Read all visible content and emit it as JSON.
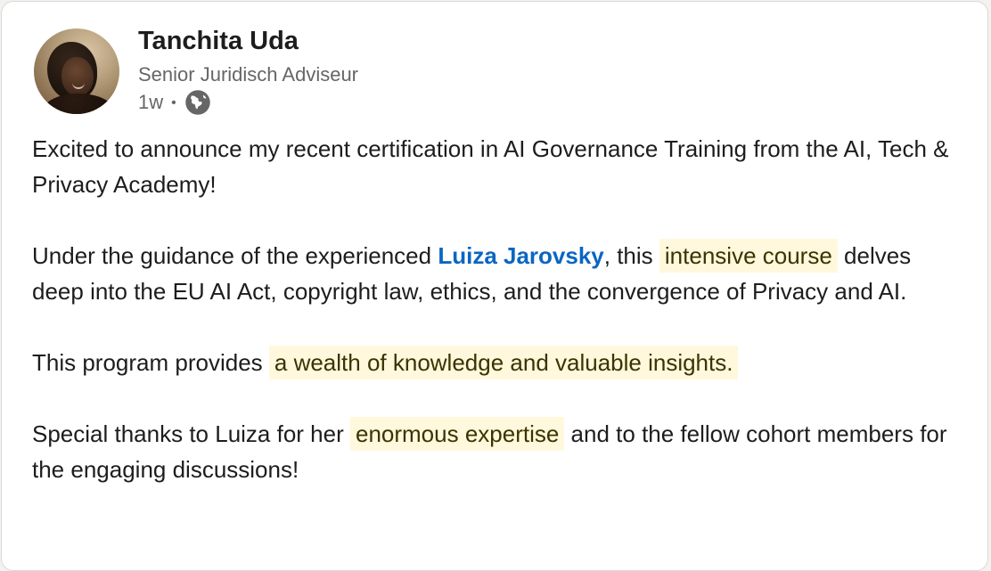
{
  "author": {
    "name": "Tanchita Uda",
    "headline": "Senior Juridisch Adviseur",
    "time_ago": "1w",
    "separator": "•",
    "visibility_icon": "globe-icon",
    "avatar_alt": "profile photo"
  },
  "post": {
    "p1": "Excited to announce my recent certification in AI Governance Training from the AI, Tech & Privacy Academy!",
    "p2_before": "Under the guidance of the experienced ",
    "p2_mention": "Luiza Jarovsky",
    "p2_middle": ", this ",
    "p2_highlight": "intensive course",
    "p2_after": " delves deep into the EU AI Act, copyright law, ethics, and the convergence of Privacy and AI.",
    "p3_before": "This program provides ",
    "p3_highlight": "a wealth of knowledge and valuable insights.",
    "p4_before": "Special thanks to Luiza for her ",
    "p4_highlight": "enormous expertise",
    "p4_after": " and to the fellow cohort members for the engaging discussions!"
  },
  "colors": {
    "mention": "#0a66c2",
    "highlight": "#fff8dc",
    "text": "#1d1d1d",
    "muted": "#666666"
  }
}
